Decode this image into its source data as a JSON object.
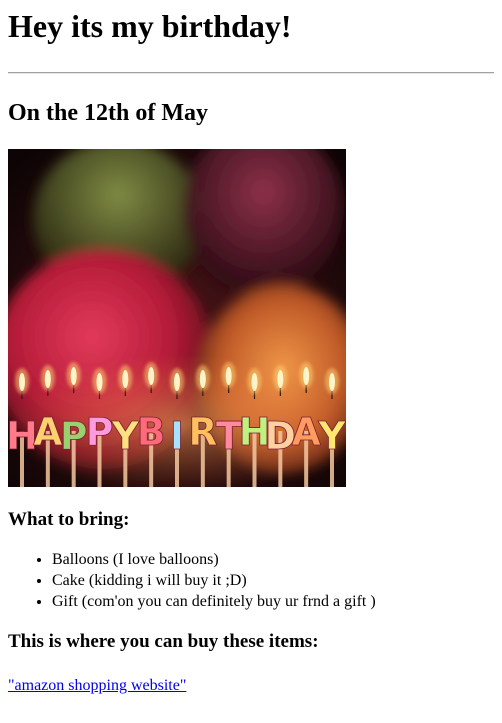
{
  "header": {
    "title": "Hey its my birthday!",
    "date": "On the 12th of May"
  },
  "image": {
    "alt": "HAPPY BIRTHDAY candles with balloons",
    "candle_text": "HAPPYBIRTHDAY",
    "colors": {
      "background": "#160608",
      "balloon_red": "#c0243e",
      "balloon_green": "#6b7a3a",
      "balloon_orange": "#d86c30",
      "flame": "#ffd890"
    }
  },
  "bring": {
    "heading": "What to bring:",
    "items": [
      "Balloons (I love balloons)",
      "Cake (kidding i will buy it ;D)",
      "Gift (com'on you can definitely buy ur frnd a gift )"
    ]
  },
  "buy": {
    "heading": "This is where you can buy these items:",
    "link_text": "\"amazon shopping website\""
  },
  "colors": {
    "link": "#0000ee",
    "text": "#000000"
  }
}
